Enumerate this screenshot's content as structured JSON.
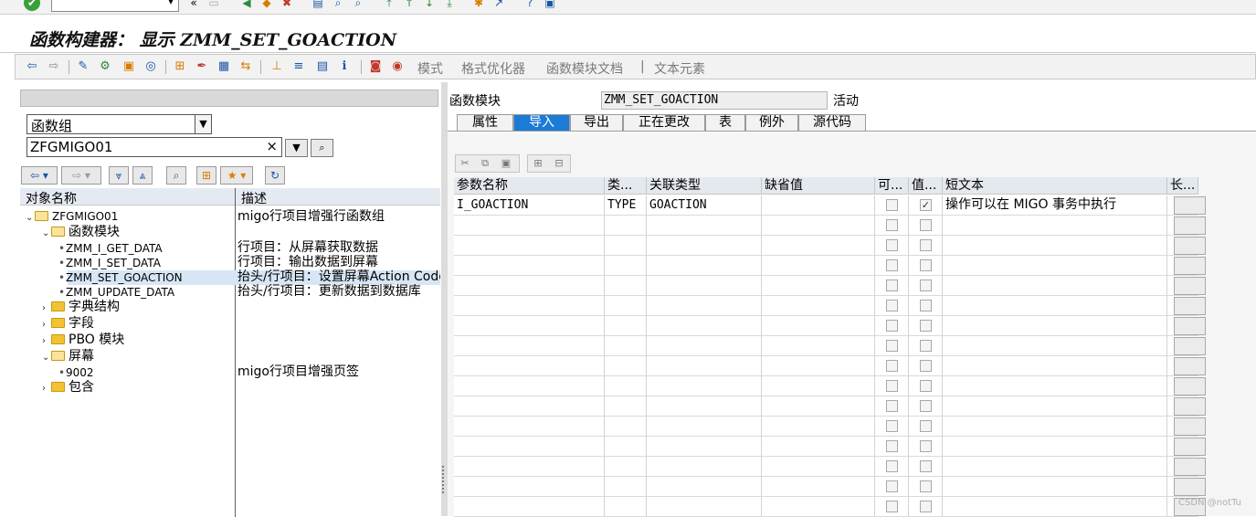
{
  "window": {
    "title": "函数构建器： 显示 ZMM_SET_GOACTION"
  },
  "system_toolbar": {
    "icons": [
      "ok-icon",
      "back-arrows-icon",
      "save-icon",
      "nav-back-icon",
      "exit-icon",
      "cancel-icon",
      "print-icon",
      "find-icon",
      "find-next-icon",
      "first-page-icon",
      "prev-page-icon",
      "next-page-icon",
      "last-page-icon",
      "new-session-icon",
      "shortcut-icon",
      "help-icon",
      "customize-icon"
    ]
  },
  "app_toolbar": {
    "text_buttons": {
      "mode": "模式",
      "pretty_printer": "格式优化器",
      "fm_docs": "函数模块文档",
      "text_elements": "文本元素"
    },
    "separator": "|"
  },
  "left_pane": {
    "object_type": "函数组",
    "object_name": "ZFGMIGO01",
    "columns": {
      "name": "对象名称",
      "desc": "描述"
    },
    "tree": {
      "root": {
        "label": "ZFGMIGO01",
        "desc": "migo行项目增强行函数组"
      },
      "fm_folder": {
        "label": "函数模块"
      },
      "fm_items": [
        {
          "label": "ZMM_I_GET_DATA",
          "desc": "行项目：从屏幕获取数据"
        },
        {
          "label": "ZMM_I_SET_DATA",
          "desc": "行项目：输出数据到屏幕"
        },
        {
          "label": "ZMM_SET_GOACTION",
          "desc": "抬头/行项目：设置屏幕Action Code"
        },
        {
          "label": "ZMM_UPDATE_DATA",
          "desc": "抬头/行项目：更新数据到数据库"
        }
      ],
      "dict_folder": {
        "label": "字典结构"
      },
      "field_folder": {
        "label": "字段"
      },
      "pbo_folder": {
        "label": "PBO 模块"
      },
      "screen_folder": {
        "label": "屏幕"
      },
      "screen_items": [
        {
          "label": "9002",
          "desc": "migo行项目增强页签"
        }
      ],
      "include_folder": {
        "label": "包含"
      }
    }
  },
  "right_pane": {
    "fm_label": "函数模块",
    "fm_name": "ZMM_SET_GOACTION",
    "fm_status": "活动",
    "tabs": [
      {
        "label": "属性",
        "active": false
      },
      {
        "label": "导入",
        "active": true
      },
      {
        "label": "导出",
        "active": false
      },
      {
        "label": "正在更改",
        "active": false
      },
      {
        "label": "表",
        "active": false
      },
      {
        "label": "例外",
        "active": false
      },
      {
        "label": "源代码",
        "active": false
      }
    ],
    "grid": {
      "headers": {
        "param": "参数名称",
        "typing": "类...",
        "assoc": "关联类型",
        "default": "缺省值",
        "optional": "可...",
        "pass_value": "值...",
        "short_text": "短文本",
        "long_text": "长..."
      },
      "rows": [
        {
          "param": "I_GOACTION",
          "typing": "TYPE",
          "assoc": "GOACTION",
          "default": "",
          "optional": false,
          "pass_value": true,
          "short_text": "操作可以在 MIGO 事务中执行"
        }
      ],
      "empty_rows": 15
    }
  },
  "watermark": "CSDN @notTu",
  "colors": {
    "active_tab": "#1d7bd8",
    "selection": "#d6e6f4",
    "folder": "#f2c233"
  }
}
